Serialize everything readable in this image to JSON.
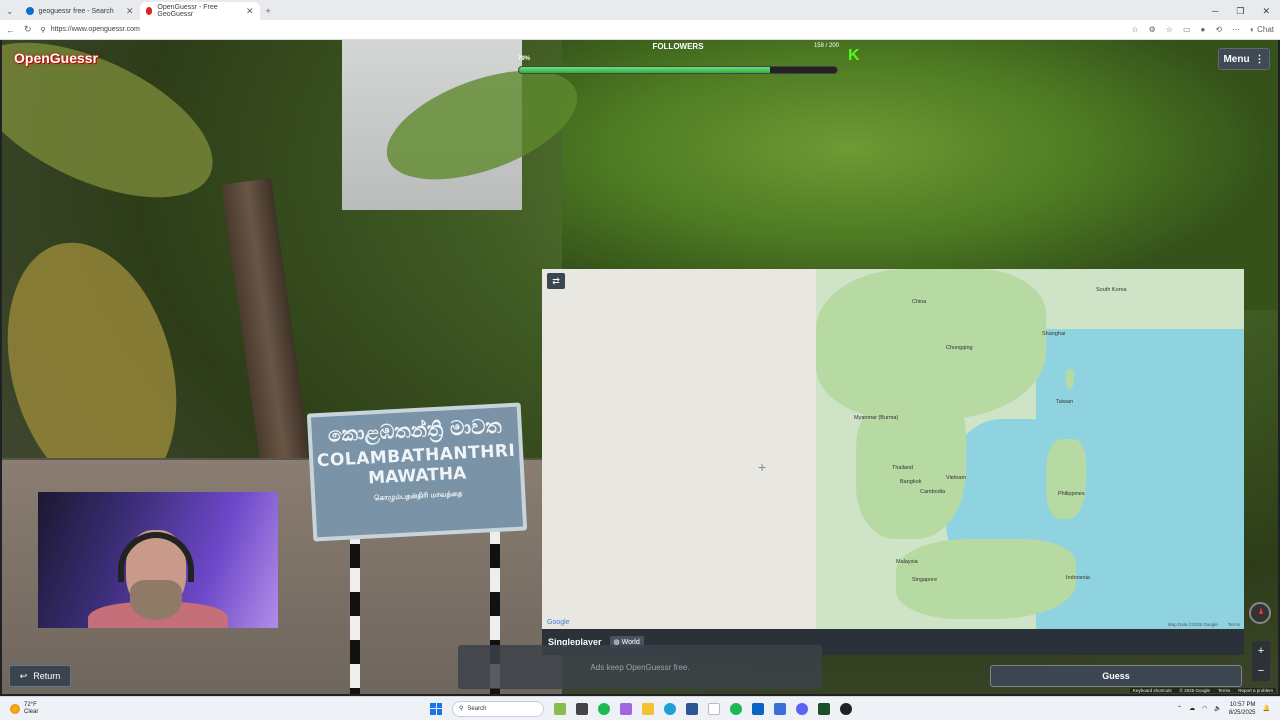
{
  "browser": {
    "tabs": [
      {
        "title": "geoguessr free - Search",
        "close": "✕"
      },
      {
        "title": "OpenGuessr - Free GeoGuessr",
        "close": "✕"
      }
    ],
    "new_tab": "+",
    "url": "https://www.openguessr.com"
  },
  "game": {
    "logo": "OpenGuessr",
    "followers": {
      "title": "FOLLOWERS",
      "percent_label": "79%",
      "percent_value": 79,
      "count": "158 / 200"
    },
    "menu_label": "Menu",
    "sign": {
      "line1": "කොළඹතන්ත්‍රි මාවත",
      "line2": "COLAMBATHANTHRI",
      "line3": "MAWATHA",
      "line4": "கொழும்பதன்திரி மாவத்தை"
    },
    "map": {
      "labels": [
        "China",
        "South Korea",
        "Chongqing",
        "Shanghai",
        "Taiwan",
        "Myanmar (Burma)",
        "Thailand",
        "Vietnam",
        "Cambodia",
        "Bangkok",
        "Philippines",
        "Malaysia",
        "Singapore",
        "Indonesia"
      ],
      "google": "Google",
      "map_data": "Map Data ©2025 Google",
      "terms": "Terms"
    },
    "mode": {
      "name": "Singleplayer",
      "scope": "World"
    },
    "ad_text": "Ads keep OpenGuessr free.",
    "return_label": "Return",
    "guess_label": "Guess",
    "zoom": {
      "in": "+",
      "out": "−"
    },
    "footer": [
      "Keyboard shortcuts",
      "© 2025 Google",
      "Terms",
      "Report a problem"
    ]
  },
  "taskbar": {
    "weather_temp": "72°F",
    "weather_desc": "Clear",
    "search_placeholder": "Search",
    "time": "10:57 PM",
    "date": "8/25/2025"
  },
  "colors": {
    "accent_green": "#2fae3f",
    "kick_green": "#53fc18",
    "logo_red": "#c00000"
  }
}
